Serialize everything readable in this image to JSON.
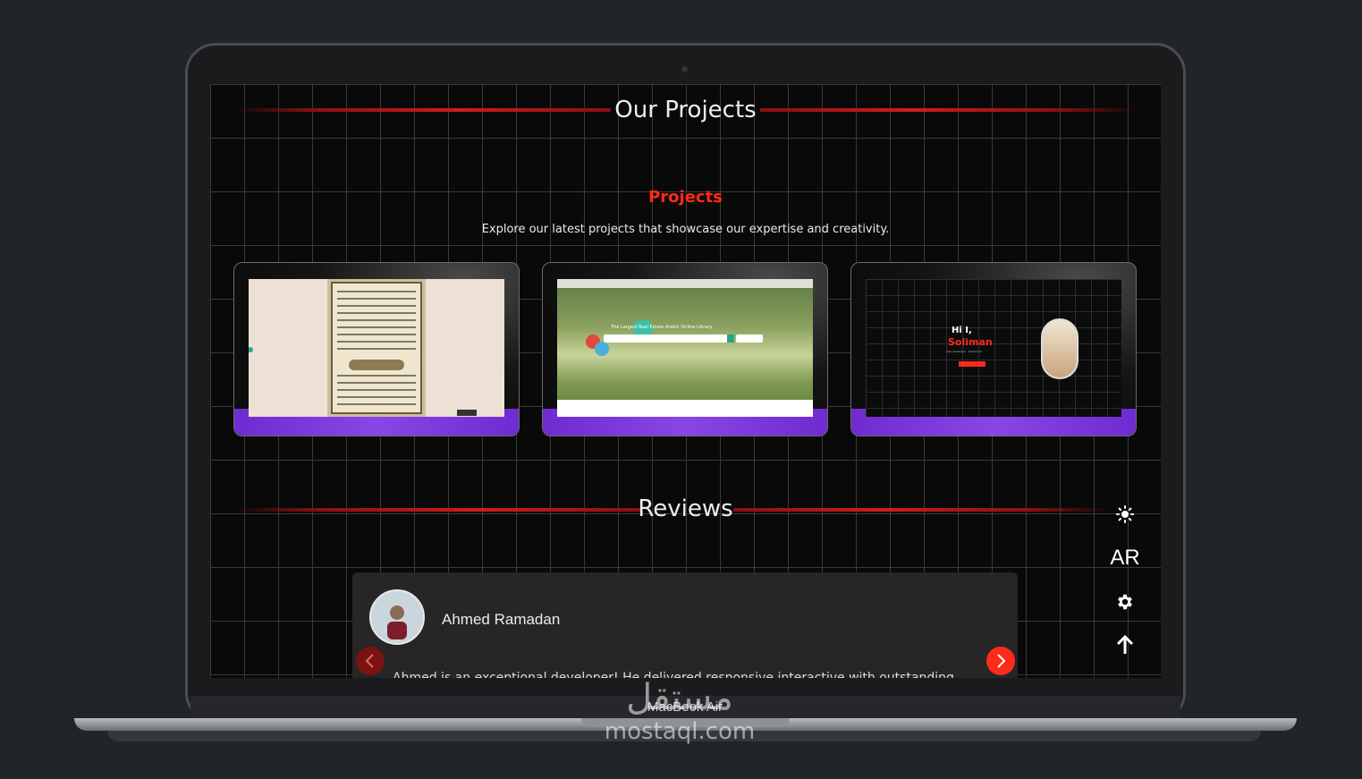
{
  "projects_section": {
    "heading": "Our Projects",
    "label": "Projects",
    "description": "Explore our latest projects that showcase our expertise and creativity.",
    "cards": [
      {
        "preview": "quran-reader"
      },
      {
        "preview": "search-homepage",
        "hero_text": "The Largest Real Estate Arabic Online Library"
      },
      {
        "preview": "portfolio",
        "greeting": "Hi I,",
        "name": "Soliman",
        "subtitle": "web developer · freelancer"
      }
    ]
  },
  "reviews_section": {
    "heading": "Reviews",
    "review": {
      "reviewer": "Ahmed Ramadan",
      "text": "Ahmed is an exceptional developer! He delivered responsive interactive with outstanding"
    },
    "prev_icon": "chevron-left-icon",
    "next_icon": "chevron-right-icon"
  },
  "floating_controls": {
    "theme_icon": "sun-icon",
    "language_label": "AR",
    "settings_icon": "gear-icon",
    "scroll_top_icon": "arrow-up-icon"
  },
  "device": {
    "model_label": "MacBook Air"
  },
  "watermark": {
    "arabic": "مستقل",
    "latin": "mostaql.com"
  },
  "colors": {
    "accent_red": "#ff2a1a",
    "purple": "#7b35dc",
    "background": "#212529"
  }
}
